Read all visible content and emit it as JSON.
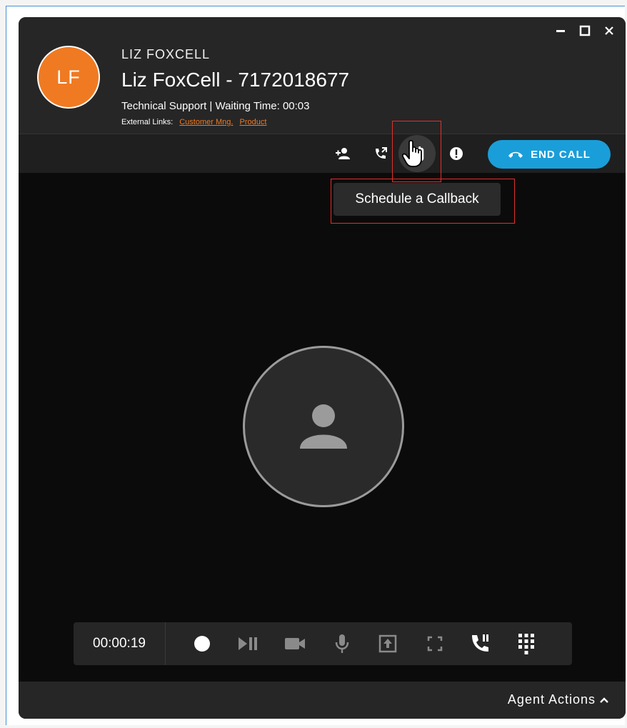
{
  "caller": {
    "initials": "LF",
    "name_upper": "LIZ FOXCELL",
    "title": "Liz FoxCell - 7172018677",
    "subtitle": "Technical Support | Waiting Time: 00:03",
    "external_links_label": "External Links:",
    "links": [
      "Customer Mng.",
      "Product"
    ]
  },
  "toolbar": {
    "icons": [
      "add-participant-icon",
      "transfer-call-icon",
      "schedule-callback-icon",
      "alert-icon"
    ],
    "end_call_label": "END CALL",
    "tooltip": "Schedule a Callback"
  },
  "controls": {
    "timer": "00:00:19",
    "icons": [
      "record-icon",
      "play-pause-icon",
      "video-icon",
      "microphone-icon",
      "share-screen-icon",
      "fullscreen-icon",
      "hold-call-icon",
      "dialpad-icon"
    ]
  },
  "footer": {
    "agent_actions_label": "Agent Actions"
  },
  "colors": {
    "accent_orange": "#f07a22",
    "end_call_blue": "#1a9ed9",
    "highlight_red": "#e0302a"
  }
}
